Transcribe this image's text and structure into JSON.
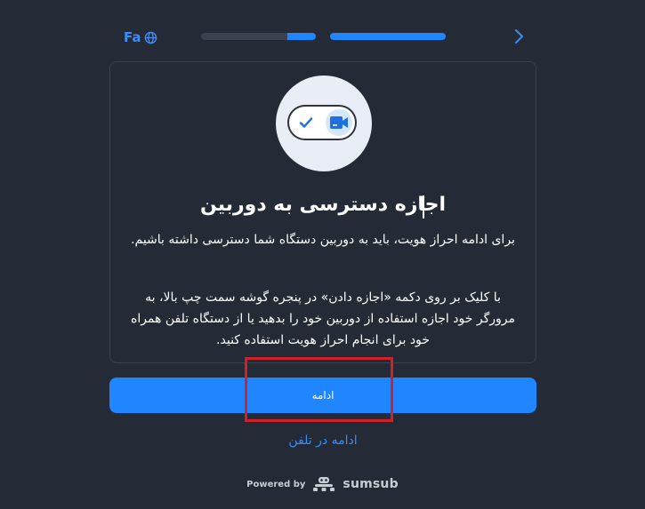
{
  "header": {
    "language_label": "Fa",
    "progress": [
      {
        "step": 1,
        "fill_fraction": 0.25
      },
      {
        "step": 2,
        "fill_fraction": 1.0
      }
    ]
  },
  "card": {
    "title": "اجازه دسترسی به دوربین",
    "paragraph_1": "برای ادامه احراز هویت، باید به دوربین دستگاه شما دسترسی داشته باشیم.",
    "paragraph_2": "با کلیک بر روی دکمه «اجازه دادن» در پنجره گوشه سمت چپ بالا، به مرورگر خود اجازه استفاده از دوربین خود را بدهید یا از دستگاه تلفن همراه خود برای انجام احراز هویت استفاده کنید."
  },
  "actions": {
    "continue_label": "ادامه",
    "continue_on_phone_label": "ادامه در تلفن"
  },
  "footer": {
    "powered_by": "Powered by",
    "brand": "sumsub"
  },
  "colors": {
    "background": "#252b36",
    "accent": "#1f86ff",
    "link": "#3d8bf5",
    "highlight": "#d0202c"
  }
}
